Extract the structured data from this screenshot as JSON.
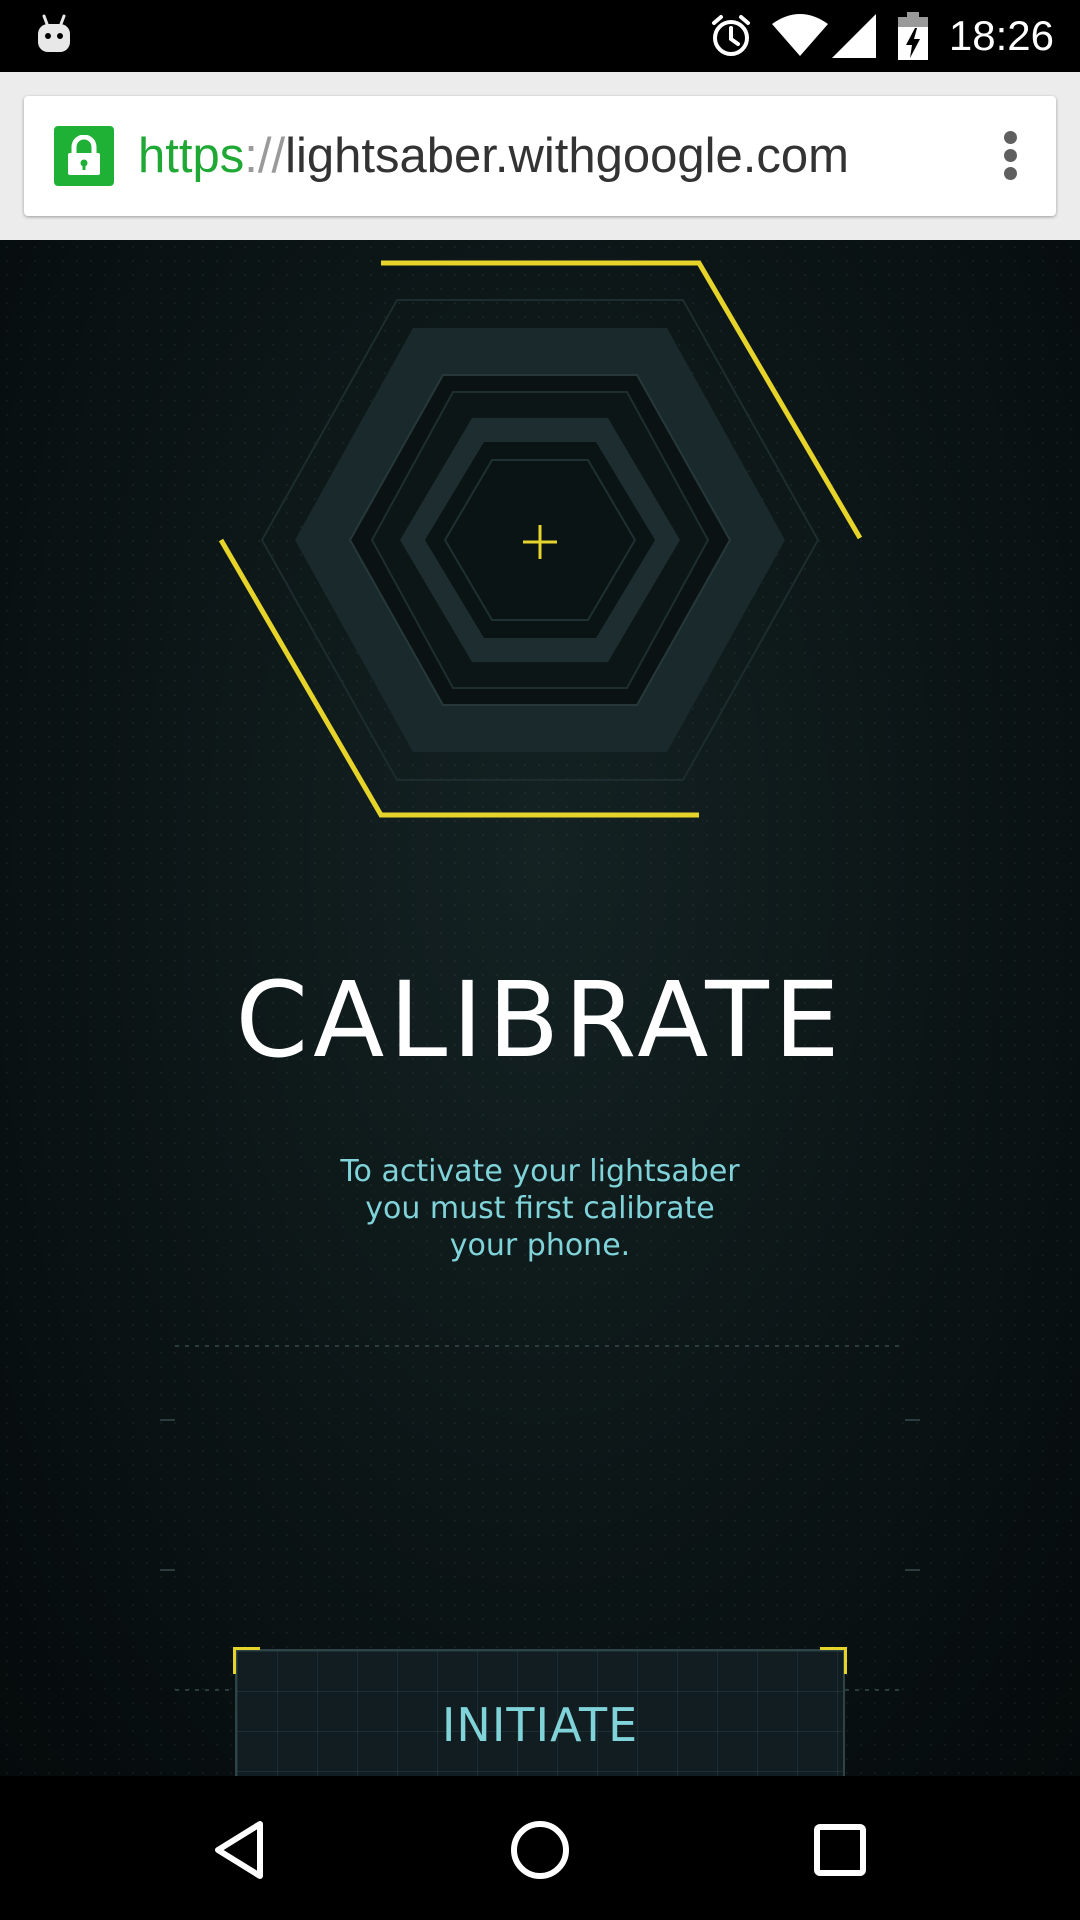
{
  "status_bar": {
    "time": "18:26",
    "icons": [
      "android-notification-icon",
      "alarm-icon",
      "wifi-icon",
      "cell-signal-icon",
      "battery-charging-icon"
    ]
  },
  "browser": {
    "url_scheme": "https",
    "url_separator": "://",
    "url_host": "lightsaber.withgoogle.com",
    "secure_icon": "lock-icon",
    "menu_icon": "more-vert-icon"
  },
  "page": {
    "title": "CALIBRATE",
    "description_lines": [
      "To activate your lightsaber",
      "you must first calibrate",
      "your phone."
    ],
    "button": {
      "label": "INITIATE"
    }
  },
  "nav_bar": {
    "buttons": [
      "back-icon",
      "home-icon",
      "recents-icon"
    ]
  },
  "colors": {
    "accent_yellow": "#e6d42a",
    "accent_cyan": "#7fd3d9",
    "secure_green": "#1fb135",
    "background": "#0d1718"
  }
}
